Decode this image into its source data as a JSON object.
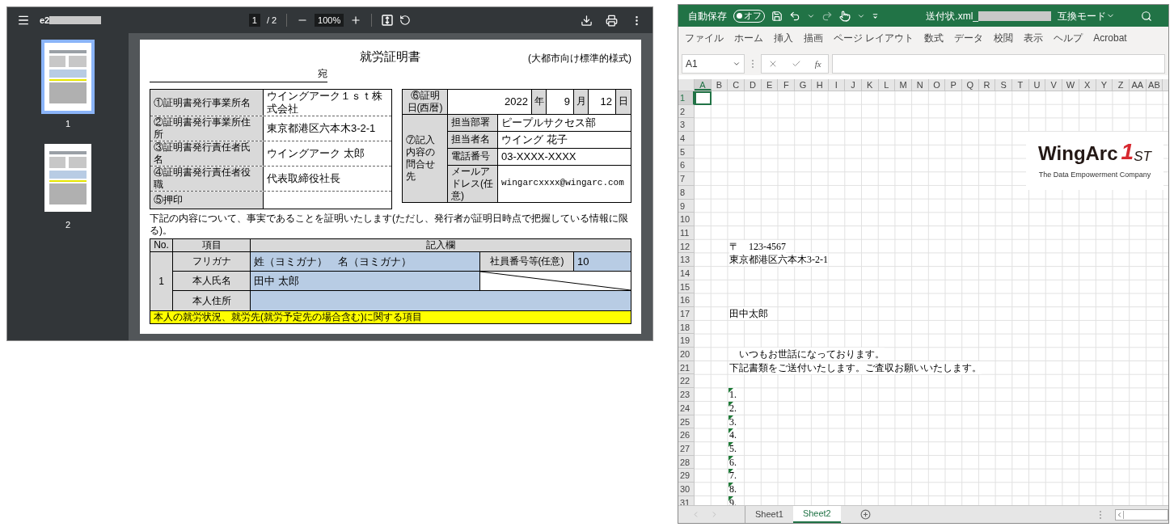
{
  "pdf_viewer": {
    "toolbar": {
      "file_name": "e2",
      "page_input": "1",
      "page_total": "/ 2",
      "zoom": "100%"
    },
    "thumbnails": [
      {
        "label": "1",
        "selected": true
      },
      {
        "label": "2",
        "selected": false
      }
    ],
    "document": {
      "title": "就労証明書",
      "subtitle": "(大都市向け標準的様式)",
      "addressee_suffix": "宛",
      "issuer_rows": [
        {
          "label": "①証明書発行事業所名",
          "value": "ウイングアーク１ｓｔ株式会社"
        },
        {
          "label": "②証明書発行事業所住所",
          "value": "東京都港区六本木3-2-1"
        },
        {
          "label": "③証明書発行責任者氏名",
          "value": "ウイングアーク 太郎"
        },
        {
          "label": "④証明書発行責任者役職",
          "value": "代表取締役社長"
        },
        {
          "label": "⑤押印"
        }
      ],
      "date": {
        "label": "⑥証明日(西暦)",
        "year": "2022",
        "year_unit": "年",
        "month": "9",
        "month_unit": "月",
        "day": "12",
        "day_unit": "日"
      },
      "contact": {
        "label": "⑦記入内容の問合せ先",
        "rows": [
          {
            "label": "担当部署",
            "value": "ピープルサクセス部"
          },
          {
            "label": "担当者名",
            "value": "ウイング 花子"
          },
          {
            "label": "電話番号",
            "value": "03-XXXX-XXXX"
          },
          {
            "label": "メールアドレス(任意)",
            "value": "wingarcxxxx@wingarc.com"
          }
        ]
      },
      "statement": "下記の内容について、事実であることを証明いたします(ただし、発行者が証明日時点で把握している情報に限る)。",
      "table": {
        "headers": [
          "No.",
          "項目",
          "記入欄"
        ],
        "row_no": "1",
        "furigana_label": "フリガナ",
        "furigana_value": "姓（ヨミガナ）　名（ヨミガナ）",
        "employee_no_label": "社員番号等(任意)",
        "employee_no_value": "10",
        "name_label": "本人氏名",
        "name_value": "田中 太郎",
        "address_label": "本人住所"
      },
      "section_bar": "本人の就労状況、就労先(就労予定先の場合含む)に関する項目"
    }
  },
  "excel": {
    "title_bar": {
      "autosave_label": "自動保存",
      "autosave": {
        "label": "オフ",
        "on": false
      },
      "file_name": "送付状.xml_",
      "mode_label": "互換モード"
    },
    "ribbon_tabs": [
      "ファイル",
      "ホーム",
      "挿入",
      "描画",
      "ページ レイアウト",
      "数式",
      "データ",
      "校閲",
      "表示",
      "ヘルプ",
      "Acrobat"
    ],
    "name_box": "A1",
    "function_label": "fx",
    "columns": [
      {
        "label": "A",
        "selected": true
      },
      {
        "label": "B",
        "selected": false
      },
      {
        "label": "C",
        "selected": false
      },
      {
        "label": "D",
        "selected": false
      },
      {
        "label": "E",
        "selected": false
      },
      {
        "label": "F",
        "selected": false
      },
      {
        "label": "G",
        "selected": false
      },
      {
        "label": "H",
        "selected": false
      },
      {
        "label": "I",
        "selected": false
      },
      {
        "label": "J",
        "selected": false
      },
      {
        "label": "K",
        "selected": false
      },
      {
        "label": "L",
        "selected": false
      },
      {
        "label": "M",
        "selected": false
      },
      {
        "label": "N",
        "selected": false
      },
      {
        "label": "O",
        "selected": false
      },
      {
        "label": "P",
        "selected": false
      },
      {
        "label": "Q",
        "selected": false
      },
      {
        "label": "R",
        "selected": false
      },
      {
        "label": "S",
        "selected": false
      },
      {
        "label": "T",
        "selected": false
      },
      {
        "label": "U",
        "selected": false
      },
      {
        "label": "V",
        "selected": false
      },
      {
        "label": "W",
        "selected": false
      },
      {
        "label": "X",
        "selected": false
      },
      {
        "label": "Y",
        "selected": false
      },
      {
        "label": "Z",
        "selected": false
      },
      {
        "label": "AA",
        "selected": false
      },
      {
        "label": "AB",
        "selected": false
      }
    ],
    "rows": [
      {
        "label": "1",
        "selected": true
      },
      {
        "label": "2",
        "selected": false
      },
      {
        "label": "3",
        "selected": false
      },
      {
        "label": "4",
        "selected": false
      },
      {
        "label": "5",
        "selected": false
      },
      {
        "label": "6",
        "selected": false
      },
      {
        "label": "7",
        "selected": false
      },
      {
        "label": "8",
        "selected": false
      },
      {
        "label": "9",
        "selected": false
      },
      {
        "label": "10",
        "selected": false
      },
      {
        "label": "11",
        "selected": false
      },
      {
        "label": "12",
        "selected": false,
        "cell": {
          "text": "〒　123-4567",
          "error_flag": false
        }
      },
      {
        "label": "13",
        "selected": false,
        "cell": {
          "text": "東京都港区六本木3-2-1",
          "error_flag": false
        }
      },
      {
        "label": "14",
        "selected": false
      },
      {
        "label": "15",
        "selected": false
      },
      {
        "label": "16",
        "selected": false
      },
      {
        "label": "17",
        "selected": false,
        "cell": {
          "text": "田中太郎",
          "error_flag": false
        }
      },
      {
        "label": "18",
        "selected": false
      },
      {
        "label": "19",
        "selected": false
      },
      {
        "label": "20",
        "selected": false,
        "cell": {
          "text": "　いつもお世話になっております。",
          "error_flag": false
        }
      },
      {
        "label": "21",
        "selected": false,
        "cell": {
          "text": "下記書類をご送付いたします。ご査収お願いいたします。",
          "error_flag": false
        }
      },
      {
        "label": "22",
        "selected": false
      },
      {
        "label": "23",
        "selected": false,
        "cell": {
          "text": "1.",
          "error_flag": true
        }
      },
      {
        "label": "24",
        "selected": false,
        "cell": {
          "text": "2.",
          "error_flag": true
        }
      },
      {
        "label": "25",
        "selected": false,
        "cell": {
          "text": "3.",
          "error_flag": true
        }
      },
      {
        "label": "26",
        "selected": false,
        "cell": {
          "text": "4.",
          "error_flag": true
        }
      },
      {
        "label": "27",
        "selected": false,
        "cell": {
          "text": "5.",
          "error_flag": true
        }
      },
      {
        "label": "28",
        "selected": false,
        "cell": {
          "text": "6.",
          "error_flag": true
        }
      },
      {
        "label": "29",
        "selected": false,
        "cell": {
          "text": "7.",
          "error_flag": true
        }
      },
      {
        "label": "30",
        "selected": false,
        "cell": {
          "text": "8.",
          "error_flag": true
        }
      },
      {
        "label": "31",
        "selected": false,
        "cell": {
          "text": "9.",
          "error_flag": true
        }
      }
    ],
    "logo": {
      "wordmark": "WingArc",
      "mark": "1",
      "suffix": "ST",
      "tagline": "The Data Empowerment Company"
    },
    "sheet_tabs": [
      {
        "label": "Sheet1",
        "selected": false
      },
      {
        "label": "Sheet2",
        "selected": true
      }
    ]
  }
}
